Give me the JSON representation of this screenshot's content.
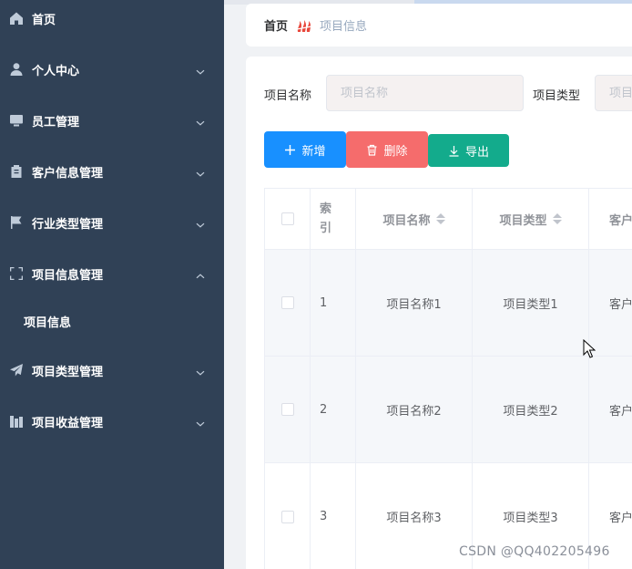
{
  "sidebar": {
    "items": [
      {
        "label": "首页",
        "icon": "home-icon",
        "expandable": false
      },
      {
        "label": "个人中心",
        "icon": "user-icon",
        "expandable": true,
        "expanded": false
      },
      {
        "label": "员工管理",
        "icon": "monitor-icon",
        "expandable": true,
        "expanded": false
      },
      {
        "label": "客户信息管理",
        "icon": "clipboard-icon",
        "expandable": true,
        "expanded": false
      },
      {
        "label": "行业类型管理",
        "icon": "flag-icon",
        "expandable": true,
        "expanded": false
      },
      {
        "label": "项目信息管理",
        "icon": "fullscreen-icon",
        "expandable": true,
        "expanded": true
      },
      {
        "label": "项目类型管理",
        "icon": "send-icon",
        "expandable": true,
        "expanded": false
      },
      {
        "label": "项目收益管理",
        "icon": "chart-icon",
        "expandable": true,
        "expanded": false
      }
    ],
    "submenu": {
      "label": "项目信息"
    }
  },
  "breadcrumb": {
    "home": "首页",
    "current": "项目信息",
    "separator_icon": "flame-logo-icon"
  },
  "search": {
    "name_label": "项目名称",
    "name_placeholder": "项目名称",
    "type_label": "项目类型",
    "type_placeholder": "项目类型"
  },
  "toolbar": {
    "add_label": "新增",
    "delete_label": "删除",
    "export_label": "导出"
  },
  "table": {
    "headers": {
      "index": "索引",
      "name": "项目名称",
      "type": "项目类型",
      "customer": "客户"
    },
    "rows": [
      {
        "index": "1",
        "name": "项目名称1",
        "type": "项目类型1",
        "customer": "客户"
      },
      {
        "index": "2",
        "name": "项目名称2",
        "type": "项目类型2",
        "customer": "客户"
      },
      {
        "index": "3",
        "name": "项目名称3",
        "type": "项目类型3",
        "customer": "客户"
      }
    ]
  },
  "watermark": "CSDN @QQ402205496",
  "colors": {
    "sidebar_bg": "#304156",
    "add_button": "#1890ff",
    "delete_button": "#f56c6c",
    "export_button": "#13ab8c"
  }
}
